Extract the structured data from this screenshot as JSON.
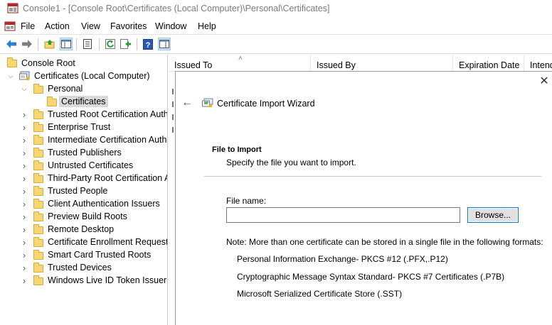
{
  "window": {
    "title": "Console1 - [Console Root\\Certificates (Local Computer)\\Personal\\Certificates]"
  },
  "menu": [
    "File",
    "Action",
    "View",
    "Favorites",
    "Window",
    "Help"
  ],
  "toolbar": {
    "buttons": [
      "back-arrow-icon",
      "forward-arrow-icon",
      "up-folder-icon",
      "show-hide-tree-icon",
      "properties-icon",
      "refresh-icon",
      "export-list-icon",
      "help-icon",
      "show-hide-action-pane-icon"
    ]
  },
  "tree": {
    "root": "Console Root",
    "store": "Certificates (Local Computer)",
    "personal": "Personal",
    "certificates": "Certificates",
    "folders": [
      "Trusted Root Certification Autho",
      "Enterprise Trust",
      "Intermediate Certification Autho",
      "Trusted Publishers",
      "Untrusted Certificates",
      "Third-Party Root Certification A",
      "Trusted People",
      "Client Authentication Issuers",
      "Preview Build Roots",
      "Remote Desktop",
      "Certificate Enrollment Requests",
      "Smart Card Trusted Roots",
      "Trusted Devices",
      "Windows Live ID Token Issuer"
    ]
  },
  "list": {
    "columns": [
      "Issued To",
      "Issued By",
      "Expiration Date",
      "Intend"
    ]
  },
  "wizard": {
    "title": "Certificate Import Wizard",
    "section_title": "File to Import",
    "section_subtitle": "Specify the file you want to import.",
    "file_label": "File name:",
    "file_value": "",
    "browse_label": "Browse...",
    "note": "Note:  More than one certificate can be stored in a single file in the following formats:",
    "formats": [
      "Personal Information Exchange- PKCS #12 (.PFX,.P12)",
      "Cryptographic Message Syntax Standard- PKCS #7 Certificates (.P7B)",
      "Microsoft Serialized Certificate Store (.SST)"
    ]
  }
}
